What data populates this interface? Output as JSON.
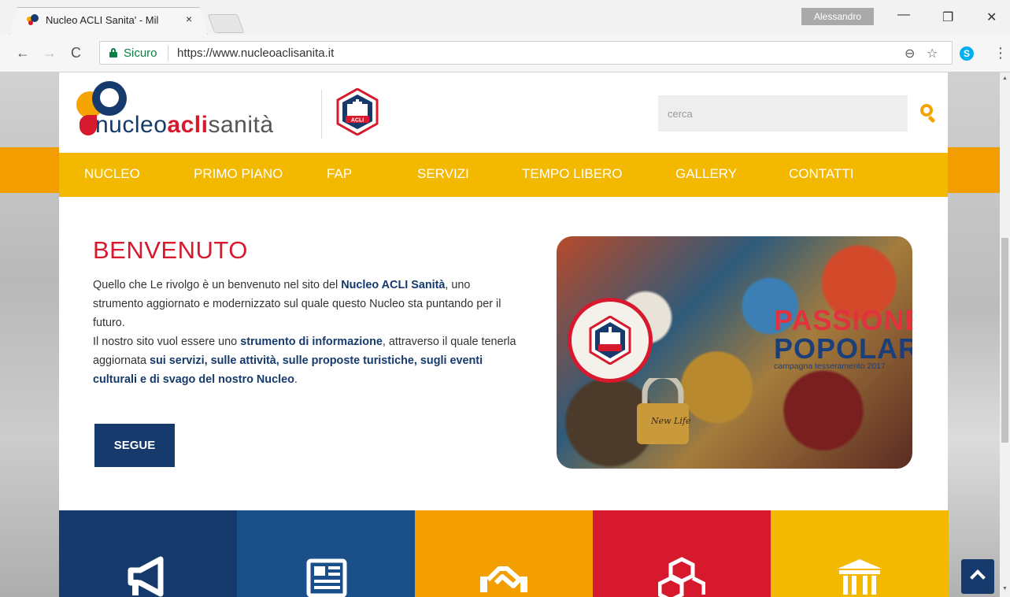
{
  "browser": {
    "tab_title": "Nucleo ACLI Sanita' - Mil",
    "tab_close": "×",
    "user": "Alessandro",
    "secure_label": "Sicuro",
    "url": "https://www.nucleoaclisanita.it",
    "window_controls": [
      "minimize",
      "restore",
      "close"
    ]
  },
  "header": {
    "logo_parts": {
      "a": "nucleo",
      "b": "acli",
      "c": "sanità"
    },
    "search_placeholder": "cerca"
  },
  "nav": {
    "items": [
      {
        "label": "NUCLEO"
      },
      {
        "label": "PRIMO PIANO"
      },
      {
        "label": "FAP"
      },
      {
        "label": "SERVIZI"
      },
      {
        "label": "TEMPO LIBERO"
      },
      {
        "label": "GALLERY"
      },
      {
        "label": "CONTATTI"
      }
    ]
  },
  "welcome": {
    "title": "BENVENUTO",
    "p1_a": "Quello che Le rivolgo è un benvenuto nel sito del ",
    "p1_b": "Nucleo ACLI Sanità",
    "p1_c": ", uno strumento aggiornato e modernizzato sul quale questo Nucleo sta puntando per il futuro.",
    "p2_a": "Il nostro sito vuol essere uno ",
    "p2_b": "strumento di informazione",
    "p2_c": ", attraverso il quale tenerla aggiornata ",
    "p2_d": "sui servizi, sulle attività, sulle proposte turistiche, sugli eventi culturali e di svago del nostro Nucleo",
    "p2_e": ".",
    "button": "SEGUE"
  },
  "banner": {
    "title1": "PASSIONE",
    "title2": "POPOLARE",
    "subtitle": "campagna tesseramento 2017",
    "padlock_text": "New Life"
  },
  "tiles": [
    {
      "icon": "megaphone-icon",
      "color": "#163a6b"
    },
    {
      "icon": "newspaper-icon",
      "color": "#1b4f8a"
    },
    {
      "icon": "handshake-icon",
      "color": "#f29e00"
    },
    {
      "icon": "cubes-icon",
      "color": "#d7192e"
    },
    {
      "icon": "institution-icon",
      "color": "#f3b900"
    }
  ],
  "colors": {
    "brand_blue": "#163a6b",
    "brand_red": "#d7192e",
    "brand_yellow": "#f3b900",
    "brand_orange": "#f29e00"
  }
}
